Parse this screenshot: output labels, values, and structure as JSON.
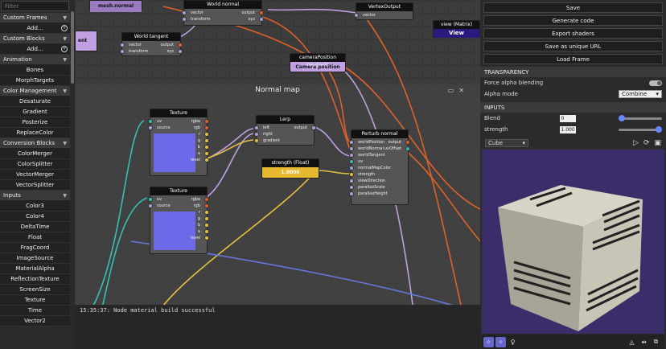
{
  "left_panel": {
    "filter_placeholder": "Filter",
    "categories": [
      {
        "label": "Custom Frames",
        "items": [
          "Add..."
        ]
      },
      {
        "label": "Custom Blocks",
        "items": [
          "Add..."
        ]
      },
      {
        "label": "Animation",
        "items": [
          "Bones",
          "MorphTargets"
        ]
      },
      {
        "label": "Color Management",
        "items": [
          "Desaturate",
          "Gradient",
          "Posterize",
          "ReplaceColor"
        ]
      },
      {
        "label": "Conversion Blocks",
        "items": [
          "ColorMerger",
          "ColorSplitter",
          "VectorMerger",
          "VectorSplitter"
        ]
      },
      {
        "label": "Inputs",
        "items": [
          "Color3",
          "Color4",
          "DeltaTime",
          "Float",
          "FragCoord",
          "ImageSource",
          "MaterialAlpha",
          "ReflectionTexture",
          "ScreenSize",
          "Texture",
          "Time",
          "Vector2"
        ]
      }
    ]
  },
  "graph": {
    "frame_title": "Normal map",
    "console_text": "15:35:37: Node material build successful",
    "nodes": {
      "mesh_normal": {
        "title": "mesh.normal"
      },
      "world_normal": {
        "title": "World normal",
        "inputs": [
          "vector",
          "transform"
        ],
        "outputs": [
          "output",
          "xyz"
        ]
      },
      "world_tangent": {
        "title": "World tangent",
        "inputs": [
          "vector",
          "transform"
        ],
        "outputs": [
          "output",
          "xyz"
        ]
      },
      "vertex_output": {
        "title": "VertexOutput",
        "inputs": [
          "vector"
        ]
      },
      "view_matrix": {
        "title": "view (Matrix)",
        "value": "View"
      },
      "camera_position": {
        "title": "cameraPosition (Vector3)",
        "value": "Camera position"
      },
      "texture1": {
        "title": "Texture",
        "inputs": [
          "uv",
          "source"
        ],
        "outputs": [
          "rgba",
          "rgb",
          "r",
          "g",
          "b",
          "a",
          "level"
        ]
      },
      "texture2": {
        "title": "Texture",
        "inputs": [
          "uv",
          "source"
        ],
        "outputs": [
          "rgba",
          "rgb",
          "r",
          "g",
          "b",
          "a",
          "level"
        ]
      },
      "lerp": {
        "title": "Lerp",
        "inputs": [
          "left",
          "right",
          "gradient"
        ],
        "outputs": [
          "output"
        ]
      },
      "strength": {
        "title": "strength (Float)",
        "value": "1.0000"
      },
      "perturb": {
        "title": "Perturb normal",
        "inputs": [
          "worldPosition",
          "worldNormal",
          "worldTangent",
          "uv",
          "normalMapColor",
          "strength",
          "viewDirection",
          "parallaxScale",
          "parallaxHeight"
        ],
        "outputs": [
          "output",
          "uvOffset"
        ]
      },
      "partial_left": {
        "title": "ent"
      }
    }
  },
  "right_panel": {
    "buttons": [
      "Save",
      "Generate code",
      "Export shaders",
      "Save as unique URL",
      "Load Frame"
    ],
    "transparency": {
      "title": "TRANSPARENCY",
      "force_alpha_label": "Force alpha blending",
      "alpha_mode_label": "Alpha mode",
      "alpha_mode_value": "Combine"
    },
    "inputs": {
      "title": "INPUTS",
      "blend_label": "Blend",
      "blend_value": "0",
      "blend_fraction": 0.0,
      "strength_label": "strength",
      "strength_value": "1.000",
      "strength_fraction": 1.0
    },
    "preview_mesh": "Cube",
    "colors": {
      "viewport_bg": "#3a2d6a",
      "accent": "#6666cc"
    }
  }
}
